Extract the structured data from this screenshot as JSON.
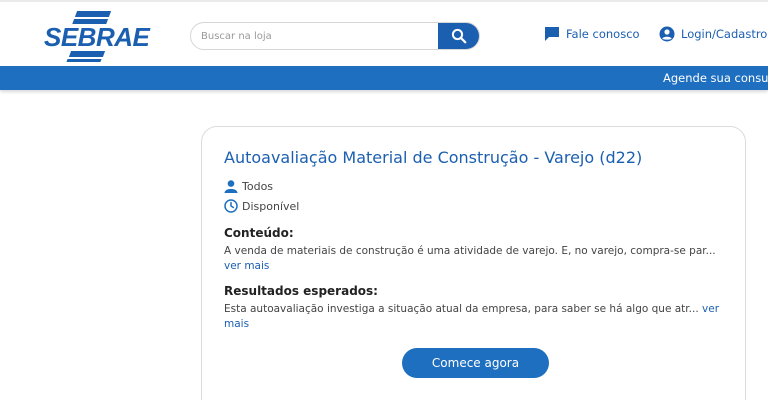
{
  "header": {
    "logo_text": "SEBRAE",
    "search": {
      "placeholder": "Buscar na loja",
      "value": ""
    },
    "contact_label": "Fale conosco",
    "login_label": "Login/Cadastro"
  },
  "banner": {
    "text": "Agende sua consu"
  },
  "card": {
    "title": "Autoavaliação Material de Construção - Varejo (d22)",
    "audience": "Todos",
    "status": "Disponível",
    "content_heading": "Conteúdo:",
    "content_text": "A venda de materiais de construção é uma atividade de varejo. E, no varejo, compra-se par...",
    "content_more": "ver mais",
    "results_heading": "Resultados esperados:",
    "results_text": "Esta autoavaliação investiga a situação atual da empresa, para saber se há algo que atr...",
    "results_more": "ver mais",
    "cta_label": "Comece agora"
  },
  "colors": {
    "brand": "#1b5fb0",
    "bar": "#1e6fc0"
  },
  "icons": [
    "search-icon",
    "chat-icon",
    "user-circle-icon",
    "user-icon",
    "clock-icon"
  ]
}
